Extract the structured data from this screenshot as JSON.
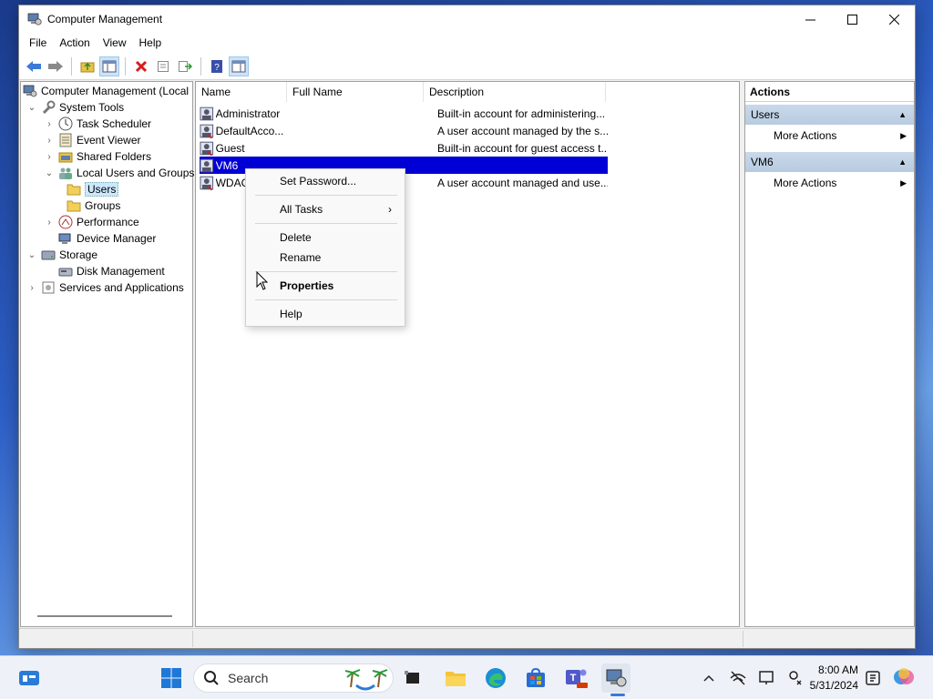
{
  "window": {
    "title": "Computer Management",
    "controls": [
      "minimize",
      "maximize",
      "close"
    ]
  },
  "menu": [
    "File",
    "Action",
    "View",
    "Help"
  ],
  "toolbar": [
    "back-icon",
    "forward-icon",
    "up-folder-icon",
    "show-hide-tree-icon",
    "delete-icon",
    "properties-icon",
    "export-list-icon",
    "help-icon",
    "show-hide-action-pane-icon"
  ],
  "tree": [
    {
      "label": "Computer Management (Local",
      "icon": "computer-management-icon",
      "expander": ""
    },
    {
      "label": "System Tools",
      "icon": "system-tools-icon",
      "expander": "expanded"
    },
    {
      "label": "Task Scheduler",
      "icon": "clock-icon",
      "expander": "collapsed"
    },
    {
      "label": "Event Viewer",
      "icon": "event-viewer-icon",
      "expander": "collapsed"
    },
    {
      "label": "Shared Folders",
      "icon": "shared-folders-icon",
      "expander": "collapsed"
    },
    {
      "label": "Local Users and Groups",
      "icon": "users-groups-icon",
      "expander": "expanded"
    },
    {
      "label": "Users",
      "icon": "folder-icon",
      "expander": "",
      "selected": true
    },
    {
      "label": "Groups",
      "icon": "folder-icon",
      "expander": ""
    },
    {
      "label": "Performance",
      "icon": "performance-icon",
      "expander": "collapsed"
    },
    {
      "label": "Device Manager",
      "icon": "device-manager-icon",
      "expander": ""
    },
    {
      "label": "Storage",
      "icon": "storage-icon",
      "expander": "expanded"
    },
    {
      "label": "Disk Management",
      "icon": "disk-icon",
      "expander": ""
    },
    {
      "label": "Services and Applications",
      "icon": "services-icon",
      "expander": "collapsed"
    }
  ],
  "list": {
    "columns": [
      "Name",
      "Full Name",
      "Description"
    ],
    "rows": [
      {
        "name": "Administrator",
        "full_name": "",
        "description": "Built-in account for administering..."
      },
      {
        "name": "DefaultAcco...",
        "full_name": "",
        "description": "A user account managed by the s..."
      },
      {
        "name": "Guest",
        "full_name": "",
        "description": "Built-in account for guest access t..."
      },
      {
        "name": "VM6",
        "full_name": "",
        "description": "",
        "selected": true
      },
      {
        "name": "WDAG",
        "full_name": "",
        "description": "A user account managed and use..."
      }
    ]
  },
  "actions": {
    "header": "Actions",
    "groups": [
      {
        "title": "Users",
        "items": [
          "More Actions"
        ]
      },
      {
        "title": "VM6",
        "items": [
          "More Actions"
        ]
      }
    ]
  },
  "context_menu": {
    "items": [
      {
        "label": "Set Password...",
        "bold": false,
        "submenu": false
      },
      {
        "label": "All Tasks",
        "bold": false,
        "submenu": true
      },
      {
        "label": "Delete",
        "bold": false,
        "submenu": false
      },
      {
        "label": "Rename",
        "bold": false,
        "submenu": false
      },
      {
        "label": "Properties",
        "bold": true,
        "submenu": false
      },
      {
        "label": "Help",
        "bold": false,
        "submenu": false
      }
    ]
  },
  "taskbar": {
    "search_placeholder": "Search",
    "apps": [
      "widgets-icon",
      "start-icon",
      "task-view-icon",
      "file-explorer-icon",
      "edge-icon",
      "store-icon",
      "teams-icon",
      "computer-management-taskbar-icon"
    ],
    "tray": [
      "chevron-up-icon",
      "network-off-icon",
      "display-icon",
      "accessibility-icon"
    ],
    "time": "8:00 AM",
    "date": "5/31/2024"
  },
  "colors": {
    "selection": "#0000d6",
    "action_group_bg": "#c9d9ea"
  }
}
